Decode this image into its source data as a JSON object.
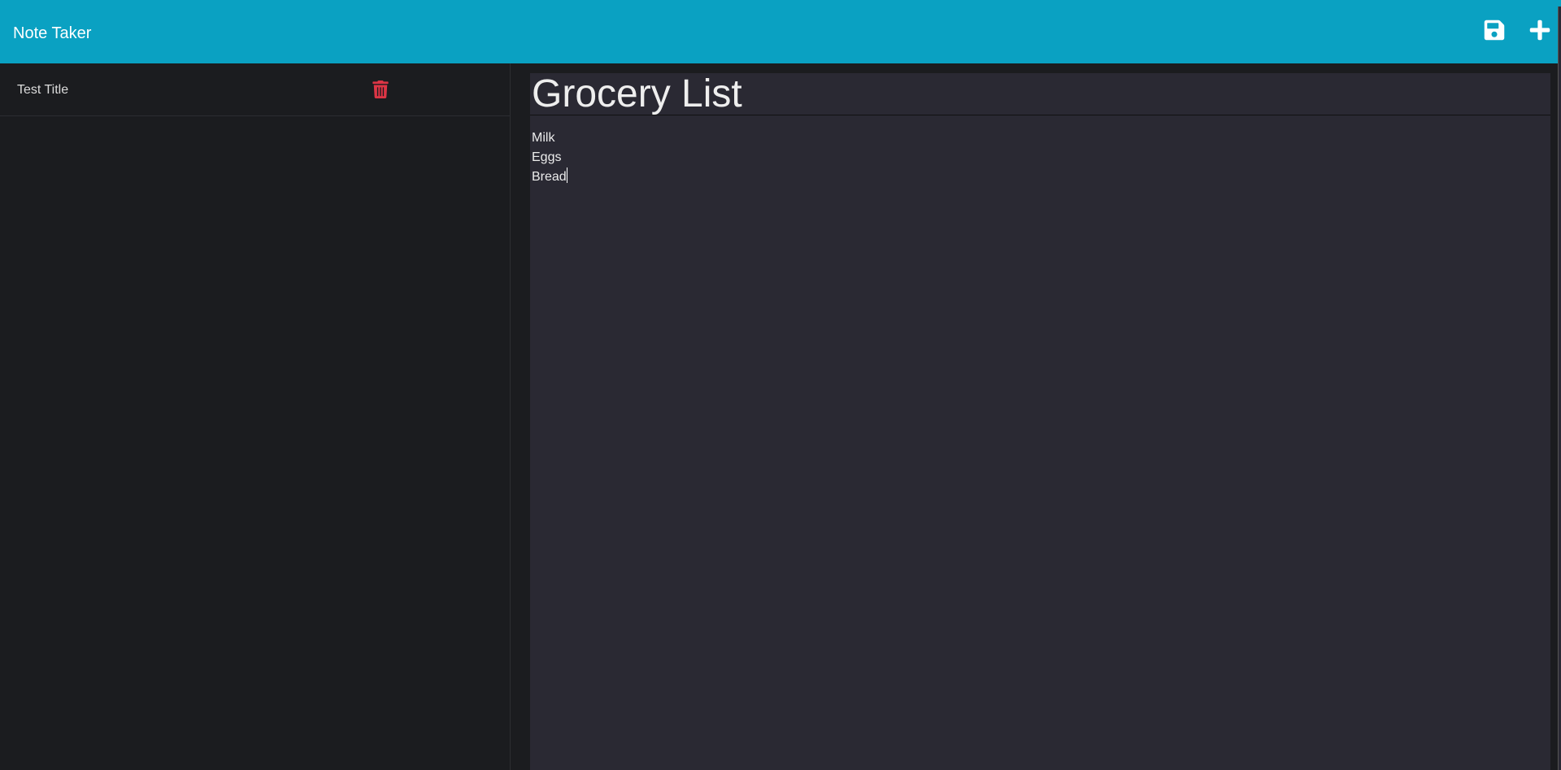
{
  "app": {
    "brand": "Note Taker"
  },
  "toolbar": {
    "save_icon": "floppy-disk-icon",
    "new_icon": "plus-icon"
  },
  "sidebar": {
    "notes": [
      {
        "title": "Test Title",
        "delete_icon": "trash-icon",
        "delete_color": "#dc3545"
      }
    ]
  },
  "editor": {
    "title": "Grocery List",
    "lines": [
      "Milk",
      "Eggs",
      "Bread"
    ]
  },
  "colors": {
    "navbar": "#0aa1c2",
    "sidebar_bg": "#1b1c1f",
    "editor_bg": "#2a2933"
  }
}
